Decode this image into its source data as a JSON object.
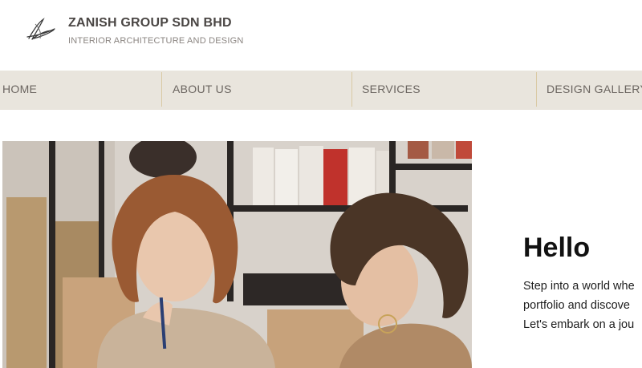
{
  "header": {
    "brand_title": "ZANISH GROUP SDN BHD",
    "brand_subtitle": "INTERIOR ARCHITECTURE AND DESIGN",
    "logo_icon": "signature-logo"
  },
  "nav": {
    "items": [
      {
        "label": "HOME"
      },
      {
        "label": "ABOUT US"
      },
      {
        "label": "SERVICES"
      },
      {
        "label": "DESIGN GALLERY"
      }
    ]
  },
  "hero": {
    "image": "photo-two-women-conversation"
  },
  "intro": {
    "title": "Hello",
    "lines": [
      "Step into a world whe",
      "portfolio and discove",
      "Let's embark on a jou"
    ]
  },
  "colors": {
    "nav_bg": "#e9e5dd",
    "nav_separator": "#d9c9a3",
    "nav_text": "#6b6560",
    "brand_text": "#4a4644"
  }
}
